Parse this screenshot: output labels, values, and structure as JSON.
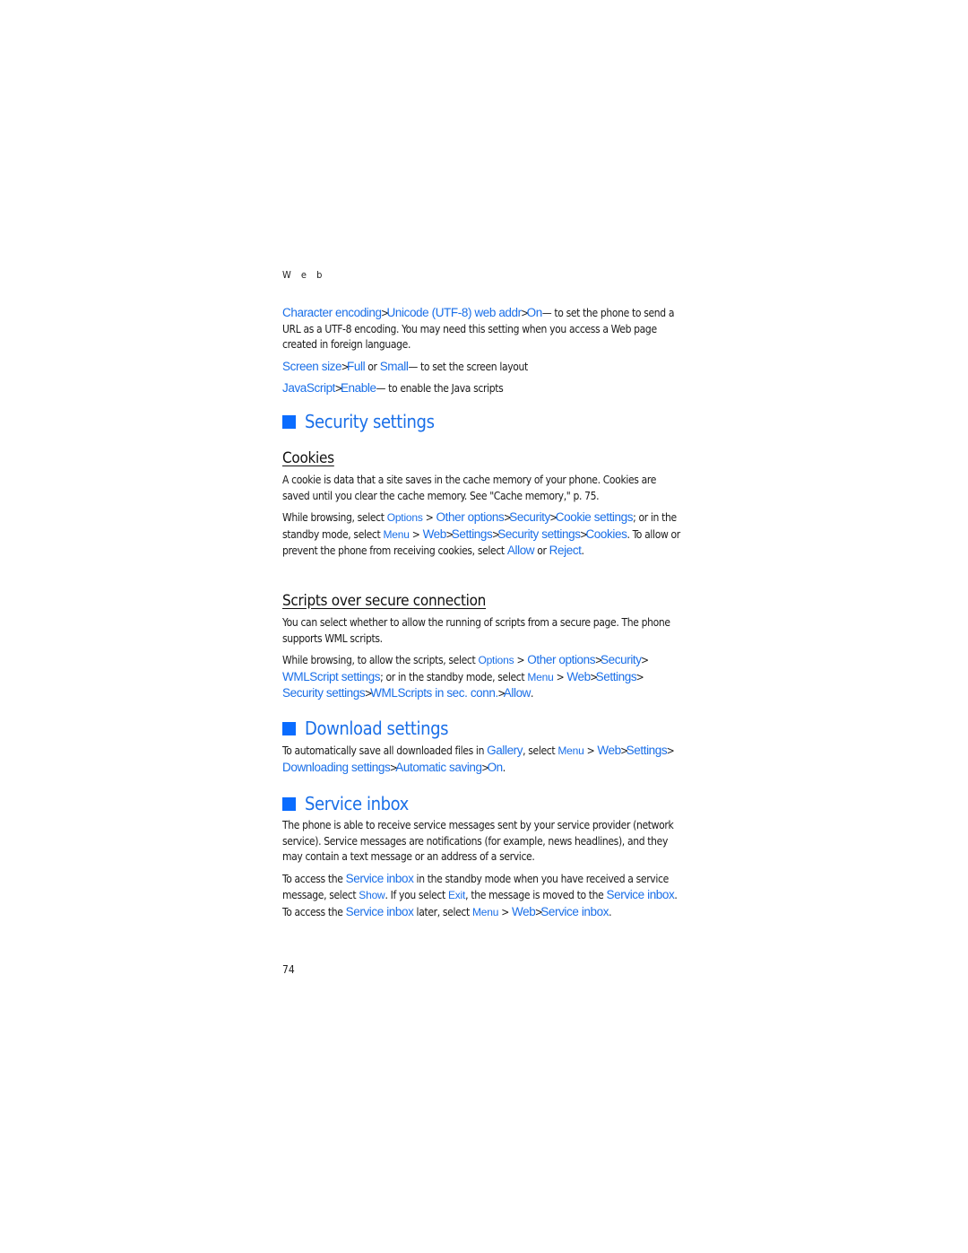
{
  "running_head": "W e b",
  "page_number": "74",
  "settings_items": [
    {
      "parts": [
        {
          "t": "Character encoding",
          "k": true
        },
        {
          "t": " > ",
          "sep": true
        },
        {
          "t": "Unicode (UTF-8) web addr",
          "k": true
        },
        {
          "t": " > ",
          "sep": true
        },
        {
          "t": "On",
          "k": true
        },
        {
          "t": "— to set the phone to send a URL as a UTF-8 encoding. You may need this setting when you access a Web page created in foreign language."
        }
      ]
    },
    {
      "parts": [
        {
          "t": "Screen size",
          "k": true
        },
        {
          "t": " > ",
          "sep": true
        },
        {
          "t": "Full",
          "k": true
        },
        {
          "t": " or "
        },
        {
          "t": "Small",
          "k": true
        },
        {
          "t": "— to set the screen layout"
        }
      ]
    },
    {
      "parts": [
        {
          "t": "JavaScript",
          "k": true
        },
        {
          "t": " > ",
          "sep": true
        },
        {
          "t": "Enable",
          "k": true
        },
        {
          "t": "— to enable the Java scripts"
        }
      ]
    }
  ],
  "security": {
    "heading": "Security settings",
    "cookies": {
      "heading": "Cookies",
      "intro": "A cookie is data that a site saves in the cache memory of your phone. Cookies are saved until you clear the cache memory. See \"Cache memory,\" p. 75.",
      "instructions": [
        {
          "t": "While browsing, select "
        },
        {
          "t": "Options",
          "m": true
        },
        {
          "t": " > "
        },
        {
          "t": "Other options",
          "k": true
        },
        {
          "t": " > ",
          "sep": true
        },
        {
          "t": "Security",
          "k": true
        },
        {
          "t": " > ",
          "sep": true
        },
        {
          "t": "Cookie settings",
          "k": true
        },
        {
          "t": "; or in the standby mode, select "
        },
        {
          "t": "Menu",
          "m": true
        },
        {
          "t": " > "
        },
        {
          "t": "Web",
          "k": true
        },
        {
          "t": " > ",
          "sep": true
        },
        {
          "t": "Settings",
          "k": true
        },
        {
          "t": " > ",
          "sep": true
        },
        {
          "t": "Security settings",
          "k": true
        },
        {
          "t": " > ",
          "sep": true
        },
        {
          "t": "Cookies",
          "k": true
        },
        {
          "t": ". To allow or prevent the phone from receiving cookies, select "
        },
        {
          "t": "Allow",
          "k": true
        },
        {
          "t": " or "
        },
        {
          "t": "Reject",
          "k": true
        },
        {
          "t": "."
        }
      ]
    },
    "scripts": {
      "heading": "Scripts over secure connection",
      "intro": "You can select whether to allow the running of scripts from a secure page. The phone supports WML scripts.",
      "instructions": [
        {
          "t": "While browsing, to allow the scripts, select "
        },
        {
          "t": "Options",
          "m": true
        },
        {
          "t": " > "
        },
        {
          "t": "Other options",
          "k": true
        },
        {
          "t": " > ",
          "sep": true
        },
        {
          "t": "Security",
          "k": true
        },
        {
          "t": " > ",
          "sep": true
        },
        {
          "t": "WMLScript settings",
          "k": true
        },
        {
          "t": "; or in the standby mode, select "
        },
        {
          "t": "Menu",
          "m": true
        },
        {
          "t": " > "
        },
        {
          "t": "Web",
          "k": true
        },
        {
          "t": " > ",
          "sep": true
        },
        {
          "t": "Settings",
          "k": true
        },
        {
          "t": " > ",
          "sep": true
        },
        {
          "t": "Security settings",
          "k": true
        },
        {
          "t": " > ",
          "sep": true
        },
        {
          "t": "WMLScripts in sec. conn.",
          "k": true
        },
        {
          "t": " > ",
          "sep": true
        },
        {
          "t": "Allow",
          "k": true
        },
        {
          "t": "."
        }
      ]
    }
  },
  "download": {
    "heading": "Download settings",
    "instructions": [
      {
        "t": "To automatically save all downloaded files in "
      },
      {
        "t": "Gallery",
        "k": true
      },
      {
        "t": ", select "
      },
      {
        "t": "Menu",
        "m": true
      },
      {
        "t": " > "
      },
      {
        "t": "Web",
        "k": true
      },
      {
        "t": " > ",
        "sep": true
      },
      {
        "t": "Settings",
        "k": true
      },
      {
        "t": " > ",
        "sep": true
      },
      {
        "t": "Downloading settings",
        "k": true
      },
      {
        "t": " > ",
        "sep": true
      },
      {
        "t": "Automatic saving",
        "k": true
      },
      {
        "t": " > ",
        "sep": true
      },
      {
        "t": "On",
        "k": true
      },
      {
        "t": "."
      }
    ]
  },
  "service_inbox": {
    "heading": "Service inbox",
    "intro": "The phone is able to receive service messages sent by your service provider (network service). Service messages are notifications (for example, news headlines), and they may contain a text message or an address of a service.",
    "instructions": [
      {
        "t": "To access the "
      },
      {
        "t": "Service inbox",
        "k": true
      },
      {
        "t": " in the standby mode when you have received a service message, select "
      },
      {
        "t": "Show",
        "m": true
      },
      {
        "t": ". If you select "
      },
      {
        "t": "Exit",
        "m": true
      },
      {
        "t": ", the message is moved to the "
      },
      {
        "t": "Service inbox",
        "k": true
      },
      {
        "t": ". To access the "
      },
      {
        "t": "Service inbox",
        "k": true
      },
      {
        "t": " later, select "
      },
      {
        "t": "Menu",
        "m": true
      },
      {
        "t": " > "
      },
      {
        "t": "Web",
        "k": true
      },
      {
        "t": " > ",
        "sep": true
      },
      {
        "t": "Service inbox",
        "k": true
      },
      {
        "t": "."
      }
    ]
  }
}
